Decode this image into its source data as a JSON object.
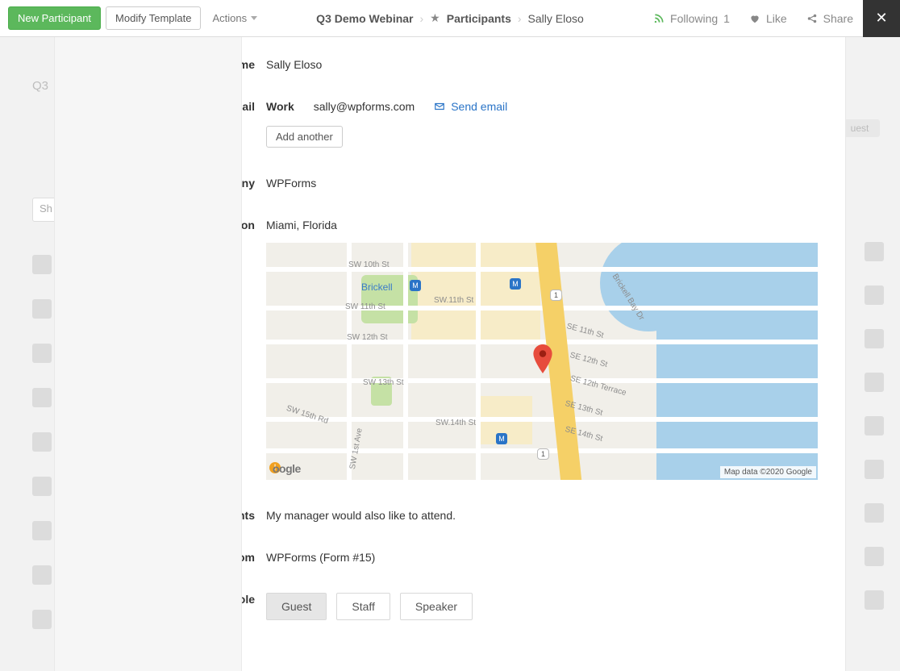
{
  "topbar": {
    "new_button": "New Participant",
    "modify_button": "Modify Template",
    "actions": "Actions",
    "crumb_root": "Q3 Demo Webinar",
    "crumb_section": "Participants",
    "crumb_leaf": "Sally Eloso",
    "following": "Following",
    "following_count": "1",
    "like": "Like",
    "share": "Share"
  },
  "bg": {
    "q3": "Q3",
    "search_placeholder": "Sh",
    "guest": "uest"
  },
  "fields": {
    "name_label": "Name",
    "name_value": "Sally Eloso",
    "email_label": "Email",
    "email_type": "Work",
    "email_value": "sally@wpforms.com",
    "send_email": "Send email",
    "add_another": "Add another",
    "company_label": "Company",
    "company_value": "WPForms",
    "location_label": "Location",
    "location_value": "Miami, Florida",
    "comments_label": "Comments",
    "comments_value": "My manager would also like to attend.",
    "registered_label": "Registered From",
    "registered_value": "WPForms (Form #15)",
    "role_label": "Role"
  },
  "roles": [
    "Guest",
    "Staff",
    "Speaker"
  ],
  "map": {
    "brickell": "Brickell",
    "hwy": "1",
    "streets": {
      "sw10": "SW 10th St",
      "sw11": "SW 11th St",
      "sw11b": "SW.11th St",
      "sw12": "SW 12th St",
      "sw13": "SW 13th St",
      "sw14": "SW.14th St",
      "sw15rd": "SW 15th Rd",
      "sw1ave": "SW 1st Ave",
      "se11": "SE 11th St",
      "se12": "SE 12th St",
      "se12t": "SE 12th Terrace",
      "se13": "SE 13th St",
      "se14": "SE 14th St",
      "bbd": "Brickell Bay Dr"
    },
    "logo": "oogle",
    "attrib": "Map data ©2020 Google"
  }
}
